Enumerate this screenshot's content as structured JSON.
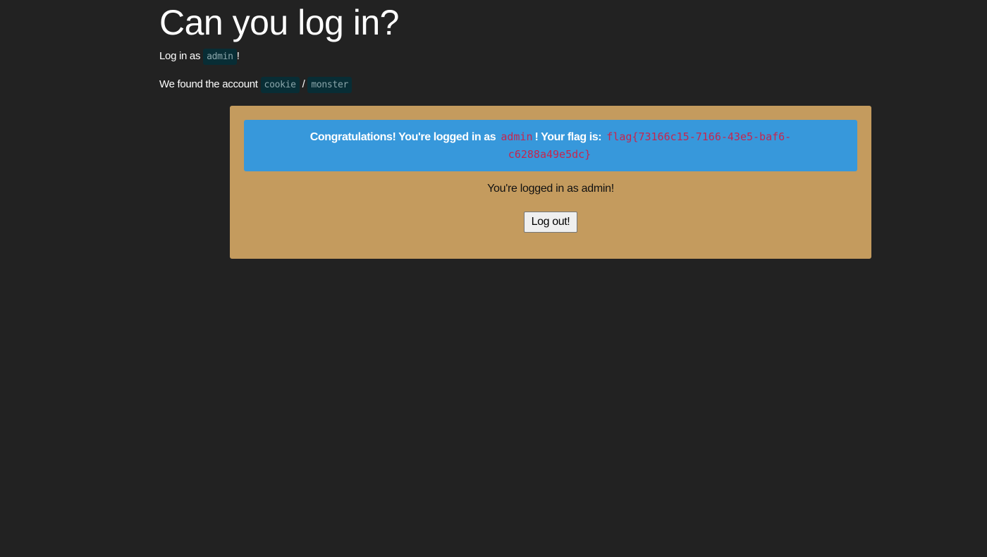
{
  "page": {
    "title": "Can you log in?"
  },
  "intro": {
    "login_prefix": "Log in as",
    "login_user": "admin",
    "login_suffix": "!",
    "account_prefix": "We found the account",
    "account_user": "cookie",
    "account_separator": "/",
    "account_pass": "monster"
  },
  "alert": {
    "prefix": "Congratulations! You're logged in as",
    "user": "admin",
    "middle": "! Your flag is:",
    "flag": "flag{73166c15-7166-43e5-baf6-c6288a49e5dc}"
  },
  "status": {
    "text": "You're logged in as admin!"
  },
  "logout": {
    "label": "Log out!"
  },
  "colors": {
    "background": "#222222",
    "panel": "#c49b5e",
    "alert": "#3798db",
    "code_highlight": "#c7254e"
  }
}
